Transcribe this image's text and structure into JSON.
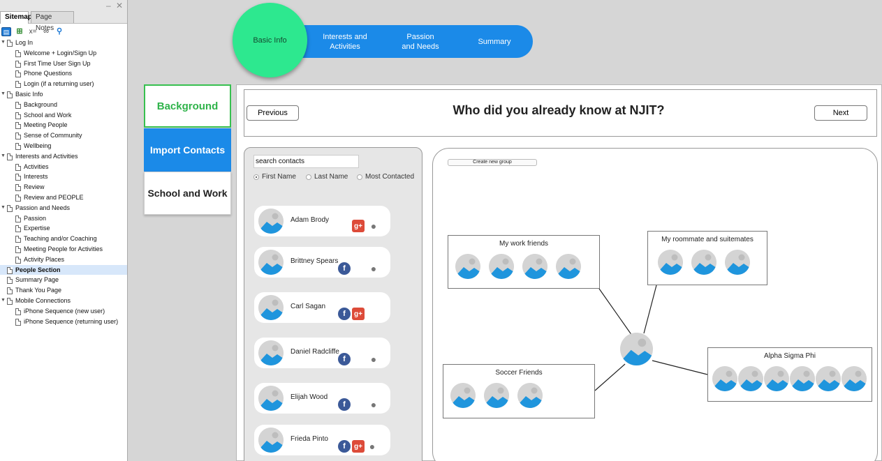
{
  "sitemap": {
    "tabs": [
      "Sitemap",
      "Page Notes"
    ],
    "window_controls": "– ✕",
    "toolbar_icons": [
      "page-icon",
      "add-page-icon",
      "variable-icon",
      "link-icon",
      "search-icon"
    ],
    "tree": [
      {
        "label": "Log In",
        "level": 0,
        "expanded": true
      },
      {
        "label": "Welcome + Login/Sign Up",
        "level": 1
      },
      {
        "label": "First Time User Sign Up",
        "level": 1
      },
      {
        "label": "Phone Questions",
        "level": 1
      },
      {
        "label": "Login (if a returning user)",
        "level": 1
      },
      {
        "label": "Basic Info",
        "level": 0,
        "expanded": true
      },
      {
        "label": "Background",
        "level": 1
      },
      {
        "label": "School and Work",
        "level": 1
      },
      {
        "label": "Meeting People",
        "level": 1
      },
      {
        "label": "Sense of Community",
        "level": 1
      },
      {
        "label": "Wellbeing",
        "level": 1
      },
      {
        "label": "Interests and Activities",
        "level": 0,
        "expanded": true
      },
      {
        "label": "Activities",
        "level": 1
      },
      {
        "label": "Interests",
        "level": 1
      },
      {
        "label": "Review",
        "level": 1
      },
      {
        "label": "Review and PEOPLE",
        "level": 1
      },
      {
        "label": "Passion and Needs",
        "level": 0,
        "expanded": true
      },
      {
        "label": "Passion",
        "level": 1
      },
      {
        "label": "Expertise",
        "level": 1
      },
      {
        "label": "Teaching and/or Coaching",
        "level": 1
      },
      {
        "label": "Meeting People for Activities",
        "level": 1
      },
      {
        "label": "Activity Places",
        "level": 1
      },
      {
        "label": "People Section",
        "level": 0,
        "selected": true
      },
      {
        "label": "Summary Page",
        "level": 0
      },
      {
        "label": "Thank You Page",
        "level": 0
      },
      {
        "label": "Mobile Connections",
        "level": 0,
        "expanded": true
      },
      {
        "label": "iPhone Sequence (new user)",
        "level": 1
      },
      {
        "label": "iPhone Sequence (returning user)",
        "level": 1
      }
    ]
  },
  "stepper": {
    "current": "Basic Info",
    "steps": [
      "Interests and\nActivities",
      "Passion\nand Needs",
      "Summary"
    ]
  },
  "left_nav": {
    "background": "Background",
    "import_contacts": "Import Contacts",
    "school_work": "School and Work"
  },
  "header": {
    "previous": "Previous",
    "title": "Who did you already know at NJIT?",
    "next": "Next"
  },
  "contacts": {
    "search_placeholder": "search contacts",
    "sort_options": [
      {
        "label": "First Name",
        "selected": true
      },
      {
        "label": "Last Name",
        "selected": false
      },
      {
        "label": "Most Contacted",
        "selected": false
      }
    ],
    "list": [
      {
        "name": "Adam Brody",
        "sources": [
          "google-plus-icon",
          "apple-icon"
        ]
      },
      {
        "name": "Brittney Spears",
        "sources": [
          "facebook-icon",
          "apple-icon"
        ]
      },
      {
        "name": "Carl Sagan",
        "sources": [
          "facebook-icon",
          "google-plus-icon"
        ]
      },
      {
        "name": "Daniel Radcliffe",
        "sources": [
          "facebook-icon",
          "apple-icon"
        ]
      },
      {
        "name": "Elijah Wood",
        "sources": [
          "facebook-icon",
          "apple-icon"
        ]
      },
      {
        "name": "Frieda Pinto",
        "sources": [
          "facebook-icon",
          "google-plus-icon",
          "apple-icon"
        ]
      }
    ]
  },
  "groups": {
    "create_label": "Create new group",
    "list": [
      {
        "title": "My work friends",
        "members": 4
      },
      {
        "title": "My roommate and suitemates",
        "members": 3
      },
      {
        "title": "Soccer Friends",
        "members": 3
      },
      {
        "title": "Alpha Sigma Phi",
        "members": 6
      }
    ]
  },
  "colors": {
    "accent_blue": "#1b8ae8",
    "accent_green": "#2de88f",
    "background_green": "#2fb34a",
    "facebook": "#3b5998",
    "google_plus": "#dd4b39"
  }
}
